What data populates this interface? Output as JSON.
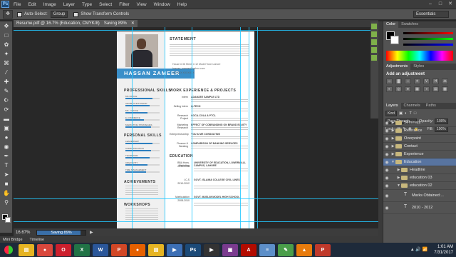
{
  "menu": [
    "File",
    "Edit",
    "Image",
    "Layer",
    "Type",
    "Select",
    "Filter",
    "View",
    "Window",
    "Help"
  ],
  "options": {
    "auto_select_label": "Auto-Select:",
    "auto_select_value": "Group",
    "transform_label": "Show Transform Controls",
    "workspace": "Essentials"
  },
  "document": {
    "tab_title": "Resume.pdf @ 16.7% (Education, CMYK/8)",
    "tab_status": "Saving 89%"
  },
  "resume": {
    "name": "HASSAN ZAMEER",
    "statement_title": "STATEMENT",
    "email": "hassan_zameer@yahoo.com",
    "phone": "+92 3XX XXXXXXX",
    "address": "House # 36 Street # 12 Model Town Lahore",
    "professional_skills_title": "PROFESSIONAL SKILLS",
    "personal_skills_title": "PERSONAL SKILLS",
    "achievements_title": "ACHIEVEMENTS",
    "workshops_title": "WORKSHOPS",
    "work_title": "WORK EXPERIENCE & PROJECTS",
    "education_title": "EDUCATION",
    "professional_skills": [
      {
        "label": "MS OFFICE",
        "level": 0.8
      },
      {
        "label": "ADOBE PHOTOSHOP",
        "level": 0.7
      },
      {
        "label": "MS - OFFICE",
        "level": 0.65
      },
      {
        "label": "E-COMMERCE",
        "level": 0.55
      },
      {
        "label": "MARKETING STRATEGIES",
        "level": 0.75
      }
    ],
    "personal_skills": [
      {
        "label": "LEADERSHIP",
        "level": 0.8
      },
      {
        "label": "COMMUNICATION",
        "level": 0.75
      },
      {
        "label": "TEAMWORK",
        "level": 0.7
      },
      {
        "label": "CREATIVITY",
        "level": 0.65
      },
      {
        "label": "TIME MANAGEMENT",
        "level": 0.6
      }
    ],
    "work": [
      {
        "title": "ADAMJEE SAMPLE LTD",
        "role": "Intern"
      },
      {
        "title": "Q-TECH",
        "role": "Selling Intern"
      },
      {
        "title": "COCA-COLA & PTCL",
        "role": "Research Project"
      },
      {
        "title": "EFFECT OF COBRANDING ON BRAND EQUITY",
        "role": "Marketing Research"
      },
      {
        "title": "YOU & ME CONSULTING",
        "role": "Entrepreneurship"
      },
      {
        "title": "COMPARISON OF BANKING SERVICES",
        "role": "Finance & Banking"
      }
    ],
    "education": [
      {
        "degree": "BBA Hons. Marketing",
        "years": "2013-2016",
        "school": "UNIVERSITY OF EDUCATION, LOWERMALL CAMPUS, LAHORE"
      },
      {
        "degree": "I.C.S",
        "years": "2010-2012",
        "school": "GOVT. ISLAMIA COLLEGE CIVIL LINES"
      },
      {
        "degree": "Matriculation",
        "years": "2008-2010",
        "school": "GOVT. MUSLIM MODEL HIGH SCHOOL"
      }
    ]
  },
  "status": {
    "zoom": "16.67%",
    "saving_label": "Saving 89%",
    "saving_fraction": 0.89
  },
  "bottom_tabs": [
    "Mini Bridge",
    "Timeline"
  ],
  "panels": {
    "color_tabs": [
      "Color",
      "Swatches"
    ],
    "adjust_tabs": [
      "Adjustments",
      "Styles"
    ],
    "adjust_title": "Add an adjustment",
    "layer_tabs": [
      "Layers",
      "Channels",
      "Paths"
    ],
    "kind_label": "Kind",
    "blend_mode": "Pass Through",
    "opacity_label": "Opacity:",
    "opacity_value": "100%",
    "lock_label": "Lock:",
    "fill_label": "Fill:",
    "fill_value": "100%"
  },
  "layers": [
    {
      "name": "Seminars",
      "type": "folder",
      "expanded": false,
      "selected": false
    },
    {
      "name": "Referance",
      "type": "folder",
      "expanded": false,
      "selected": false
    },
    {
      "name": "Overpoint",
      "type": "folder",
      "expanded": false,
      "selected": false
    },
    {
      "name": "Contact",
      "type": "folder",
      "expanded": false,
      "selected": false
    },
    {
      "name": "Experience",
      "type": "folder",
      "expanded": false,
      "selected": false
    },
    {
      "name": "Education",
      "type": "folder",
      "expanded": true,
      "selected": true
    },
    {
      "name": "Headline",
      "type": "folder",
      "expanded": false,
      "selected": false
    },
    {
      "name": "education 03",
      "type": "folder",
      "expanded": false,
      "selected": false
    },
    {
      "name": "education 02",
      "type": "folder",
      "expanded": true,
      "selected": false
    },
    {
      "name": "Marks Obtained:...",
      "type": "text",
      "expanded": false,
      "selected": false
    },
    {
      "name": "2010 - 2012",
      "type": "text",
      "expanded": false,
      "selected": false
    }
  ],
  "taskbar": {
    "apps": [
      "file-explorer",
      "chrome",
      "opera",
      "excel",
      "word",
      "powerpoint",
      "firefox",
      "folder",
      "windows-media",
      "photoshop",
      "media-player",
      "winrar",
      "acrobat",
      "notepad",
      "paint",
      "vlc",
      "pdf"
    ],
    "time": "1:01 AM",
    "date": "7/31/2017"
  },
  "colors": {
    "accent_blue": "#3a8fc9",
    "skill_bar": "#2d7fbf",
    "guide": "#22c8ff",
    "layer_selected": "#5874a0"
  }
}
